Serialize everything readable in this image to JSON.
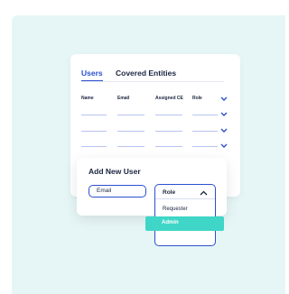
{
  "tabs": [
    {
      "label": "Users",
      "active": true
    },
    {
      "label": "Covered Entities",
      "active": false
    }
  ],
  "table": {
    "columns": [
      "Name",
      "Email",
      "Assigned CE",
      "Role"
    ],
    "row_count": 3
  },
  "dialog": {
    "title": "Add New User",
    "email_placeholder": "Email",
    "role_label": "Role",
    "role_options": [
      "Requester",
      "Admin"
    ],
    "highlighted_option": "Admin"
  },
  "colors": {
    "accent": "#2b4fd0",
    "highlight": "#3fd6c7",
    "background": "#e6f6f6",
    "text": "#1a2440"
  },
  "icons": {
    "row_dropdown": "chevron-down-icon",
    "role_dropdown": "chevron-up-icon"
  }
}
